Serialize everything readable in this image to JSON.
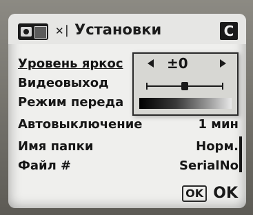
{
  "header": {
    "title": "Установки",
    "tab_badge": "C",
    "icons": [
      "camera-mode-icon",
      "tools-icon"
    ]
  },
  "menu": {
    "items": [
      {
        "label": "Уровень яркос",
        "value": "",
        "selected": true
      },
      {
        "label": "Видеовыход",
        "value": ""
      },
      {
        "label": "Режим переда",
        "value": ""
      },
      {
        "label": "Автовыключение",
        "value": "1 мин"
      },
      {
        "label": "Имя папки",
        "value": "Норм."
      },
      {
        "label": "Файл #",
        "value": "SerialNo"
      }
    ]
  },
  "popup": {
    "value": "±0",
    "level": 0
  },
  "footer": {
    "ok_button": "OK",
    "ok_label": "OK"
  },
  "colors": {
    "screen": "#efefed",
    "text": "#161616"
  }
}
